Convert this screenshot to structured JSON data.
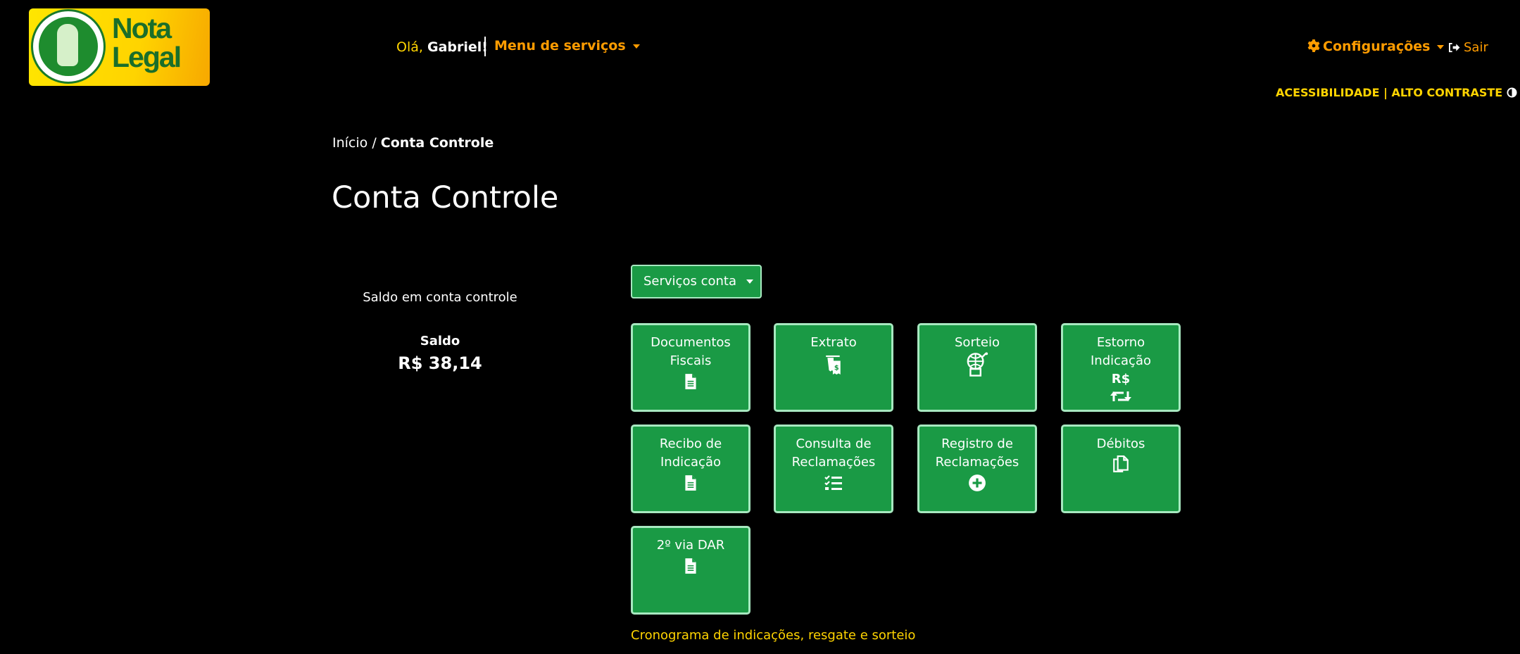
{
  "header": {
    "logo_text": "Nota Legal",
    "greeting_prefix": "Olá,",
    "greeting_name": "Gabriel!",
    "menu_label": "Menu de serviços",
    "config_label": "Configurações",
    "logout_label": "Sair",
    "accessibility_label": "ACESSIBILIDADE | ALTO CONTRASTE"
  },
  "breadcrumb": {
    "home": "Início",
    "separator": "/",
    "current": "Conta Controle"
  },
  "page_title": "Conta Controle",
  "balance": {
    "label": "Saldo em conta controle",
    "title": "Saldo",
    "value": "R$ 38,14"
  },
  "services_dropdown": {
    "label": "Serviços conta"
  },
  "tiles": [
    {
      "label": "Documentos Fiscais",
      "icon": "document-icon"
    },
    {
      "label": "Extrato",
      "icon": "receipt-money-icon"
    },
    {
      "label": "Sorteio",
      "icon": "globe-raffle-icon"
    },
    {
      "label": "Estorno Indicação",
      "icon_text": "R$",
      "icon": "retweet-icon"
    },
    {
      "label": "Recibo de Indicação",
      "icon": "document-icon"
    },
    {
      "label": "Consulta de Reclamações",
      "icon": "tasks-icon"
    },
    {
      "label": "Registro de Reclamações",
      "icon": "plus-circle-icon"
    },
    {
      "label": "Débitos",
      "icon": "copy-icon"
    },
    {
      "label": "2º via DAR",
      "icon": "document-icon"
    }
  ],
  "schedule_link": "Cronograma de indicações, resgate e sorteio",
  "colors": {
    "background": "#000000",
    "tile": "#1a9a45",
    "tile_border": "#a7e8c0",
    "accent_orange": "#ff9c00",
    "accent_yellow": "#ffd400"
  }
}
